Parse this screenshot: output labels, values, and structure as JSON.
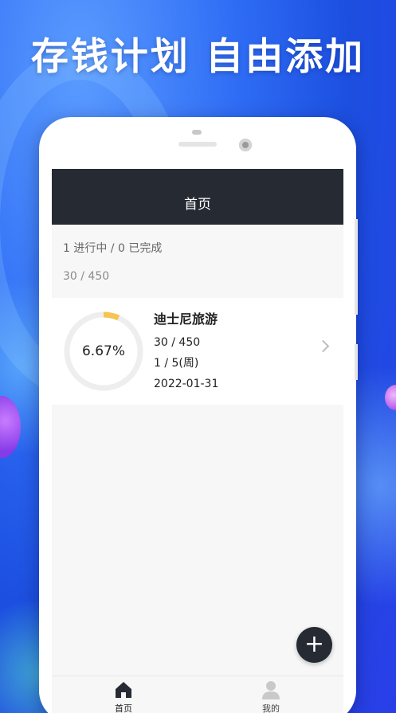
{
  "promo": {
    "headline": "存钱计划 自由添加"
  },
  "header": {
    "title": "首页"
  },
  "summary": {
    "status": "1 进行中 / 0 已完成",
    "amount": "30 / 450"
  },
  "plans": [
    {
      "name": "迪士尼旅游",
      "amount": "30 / 450",
      "period": "1 / 5(周)",
      "date": "2022-01-31",
      "progress_label": "6.67%",
      "progress": 0.0667,
      "progress_color": "#f5c451",
      "track_color": "#eeeeee"
    }
  ],
  "fab": {
    "icon": "plus-icon",
    "symbol": "+"
  },
  "tabbar": {
    "items": [
      {
        "label": "首页",
        "icon": "home-icon",
        "active": true
      },
      {
        "label": "我的",
        "icon": "user-icon",
        "active": false
      }
    ]
  },
  "colors": {
    "header_bg": "#262a33",
    "brand_blue": "#2f6df5"
  }
}
